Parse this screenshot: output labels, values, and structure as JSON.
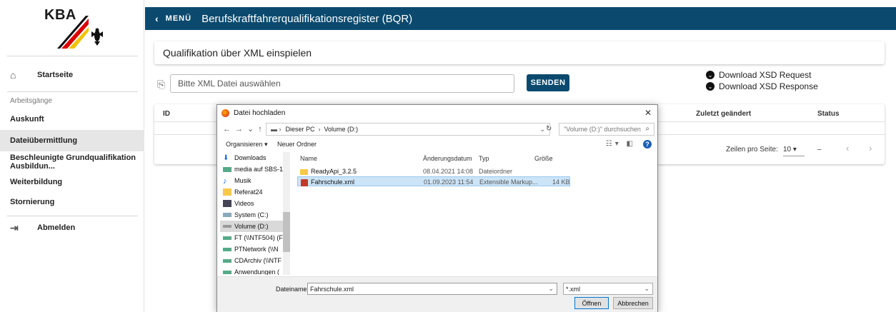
{
  "brand": {
    "logo_text": "KBA"
  },
  "sidebar": {
    "home": "Startseite",
    "section_label": "Arbeitsgänge",
    "items": [
      {
        "label": "Auskunft"
      },
      {
        "label": "Dateiübermittlung"
      },
      {
        "label": "Beschleunigte Grundqualifikation Ausbildun..."
      },
      {
        "label": "Weiterbildung"
      },
      {
        "label": "Stornierung"
      }
    ],
    "logout": "Abmelden"
  },
  "header": {
    "back_icon": "chevron-left-icon",
    "menu_label": "MENÜ",
    "title": "Berufskraftfahrerqualifikationsregister (BQR)"
  },
  "card": {
    "title": "Qualifikation über XML einspielen"
  },
  "upload": {
    "placeholder": "Bitte XML Datei auswählen",
    "send_label": "SENDEN"
  },
  "downloads": [
    {
      "label": "Download XSD Request"
    },
    {
      "label": "Download XSD Response"
    }
  ],
  "table": {
    "col_id": "ID",
    "col_changed": "Zuletzt geändert",
    "col_status": "Status",
    "rows_per_page_label": "Zeilen pro Seite:",
    "rows_per_page": "10",
    "range": "–"
  },
  "dialog": {
    "title": "Datei hochladen",
    "path": [
      "Dieser PC",
      "Volume (D:)"
    ],
    "search_placeholder": "\"Volume (D:)\" durchsuchen",
    "organize": "Organisieren",
    "new_folder": "Neuer Ordner",
    "nav": [
      {
        "label": "Downloads"
      },
      {
        "label": "media auf SBS-1"
      },
      {
        "label": "Musik"
      },
      {
        "label": "Referat24"
      },
      {
        "label": "Videos"
      },
      {
        "label": "System (C:)"
      },
      {
        "label": "Volume (D:)"
      },
      {
        "label": "FT (\\\\NTF504) (F"
      },
      {
        "label": "PTNetwork (\\\\N"
      },
      {
        "label": "CDArchiv (\\\\NTF"
      },
      {
        "label": "Anwendungen ("
      }
    ],
    "columns": {
      "name": "Name",
      "modified": "Änderungsdatum",
      "type": "Typ",
      "size": "Größe"
    },
    "files": [
      {
        "name": "ReadyApi_3.2.5",
        "modified": "08.04.2021 14:08",
        "type": "Dateiordner",
        "size": ""
      },
      {
        "name": "Fahrschule.xml",
        "modified": "01.09.2023 11:54",
        "type": "Extensible Markup...",
        "size": "14 KB"
      }
    ],
    "filename_label": "Dateiname:",
    "filename": "Fahrschule.xml",
    "filetype": "*.xml",
    "open_label": "Öffnen",
    "cancel_label": "Abbrechen"
  }
}
